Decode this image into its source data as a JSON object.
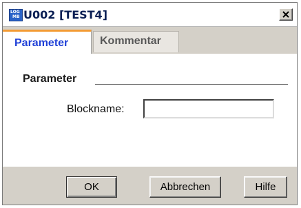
{
  "window": {
    "icon_label_top": "LOG",
    "icon_label_bottom": "MB",
    "title": "U002 [TEST4]",
    "close_glyph": "x"
  },
  "tabs": [
    {
      "label": "Parameter",
      "active": true
    },
    {
      "label": "Kommentar",
      "active": false
    }
  ],
  "content": {
    "group_label": "Parameter",
    "blockname_label": "Blockname:",
    "blockname_value": ""
  },
  "buttons": {
    "ok": "OK",
    "cancel": "Abbrechen",
    "help": "Hilfe"
  },
  "colors": {
    "active_tab_accent": "#f39b34",
    "active_tab_text": "#1e3fd7",
    "title_icon": "#2a63c8",
    "dialog_background": "#d4d0c8"
  }
}
